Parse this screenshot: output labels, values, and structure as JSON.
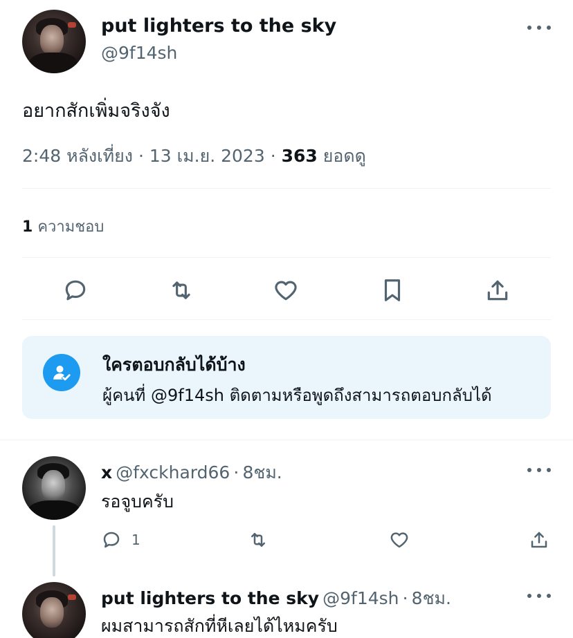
{
  "main_tweet": {
    "display_name": "put lighters to the sky",
    "handle": "@9f14sh",
    "text": "อยากสักเพิ่มจริงจัง",
    "time": "2:48 หลังเที่ยง",
    "date": "13 เม.ย. 2023",
    "views_count": "363",
    "views_label": "ยอดดู",
    "likes_count": "1",
    "likes_label": "ความชอบ",
    "actions": [
      "reply-icon",
      "retweet-icon",
      "heart-icon",
      "bookmark-icon",
      "share-icon"
    ]
  },
  "reply_restriction": {
    "title": "ใครตอบกลับได้บ้าง",
    "subtitle": "ผู้คนที่ @9f14sh ติดตามหรือพูดถึงสามารถตอบกลับได้"
  },
  "replies": [
    {
      "display_name": "x",
      "handle": "@fxckhard66",
      "time": "8ชม.",
      "text": "รอจูบครับ",
      "reply_count": "1"
    },
    {
      "display_name": "put lighters to the sky",
      "handle": "@9f14sh",
      "time": "8ชม.",
      "text": "ผมสามารถสักที่หีเลยได้ไหมครับ"
    }
  ],
  "separator": "·",
  "colors": {
    "accent": "#1d9bf0",
    "text_primary": "#0f1419",
    "text_secondary": "#536471",
    "divider": "#eff3f4",
    "card_bg": "#eaf6fc"
  }
}
